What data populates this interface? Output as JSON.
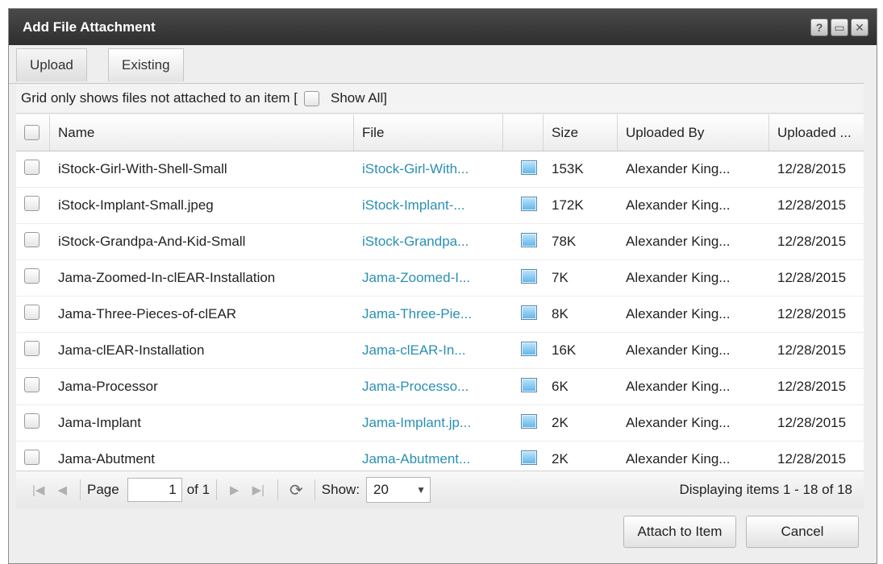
{
  "dialog": {
    "title": "Add File Attachment",
    "help_glyph": "?",
    "maximize_glyph": "▭",
    "close_glyph": "✕"
  },
  "tabs": [
    {
      "label": "Upload"
    },
    {
      "label": "Existing"
    }
  ],
  "filter": {
    "text_before": "Grid only shows files not attached to an item [",
    "show_all_label": "Show All]",
    "show_all_checked": false
  },
  "columns": [
    "Name",
    "File",
    "",
    "Size",
    "Uploaded By",
    "Uploaded ..."
  ],
  "rows": [
    {
      "name": "iStock-Girl-With-Shell-Small",
      "file": "iStock-Girl-With...",
      "size": "153K",
      "by": "Alexander King...",
      "date": "12/28/2015"
    },
    {
      "name": "iStock-Implant-Small.jpeg",
      "file": "iStock-Implant-...",
      "size": "172K",
      "by": "Alexander King...",
      "date": "12/28/2015"
    },
    {
      "name": "iStock-Grandpa-And-Kid-Small",
      "file": "iStock-Grandpa...",
      "size": "78K",
      "by": "Alexander King...",
      "date": "12/28/2015"
    },
    {
      "name": "Jama-Zoomed-In-clEAR-Installation",
      "file": "Jama-Zoomed-I...",
      "size": "7K",
      "by": "Alexander King...",
      "date": "12/28/2015"
    },
    {
      "name": "Jama-Three-Pieces-of-clEAR",
      "file": "Jama-Three-Pie...",
      "size": "8K",
      "by": "Alexander King...",
      "date": "12/28/2015"
    },
    {
      "name": "Jama-clEAR-Installation",
      "file": "Jama-clEAR-In...",
      "size": "16K",
      "by": "Alexander King...",
      "date": "12/28/2015"
    },
    {
      "name": "Jama-Processor",
      "file": "Jama-Processo...",
      "size": "6K",
      "by": "Alexander King...",
      "date": "12/28/2015"
    },
    {
      "name": "Jama-Implant",
      "file": "Jama-Implant.jp...",
      "size": "2K",
      "by": "Alexander King...",
      "date": "12/28/2015"
    },
    {
      "name": "Jama-Abutment",
      "file": "Jama-Abutment...",
      "size": "2K",
      "by": "Alexander King...",
      "date": "12/28/2015"
    }
  ],
  "pager": {
    "first_glyph": "|◀",
    "prev_glyph": "◀",
    "next_glyph": "▶",
    "last_glyph": "▶|",
    "refresh_glyph": "⟳",
    "page_label": "Page",
    "page_value": "1",
    "of_label": "of 1",
    "show_label": "Show:",
    "show_value": "20",
    "show_arrow": "▼",
    "display_text": "Displaying items 1 - 18 of 18"
  },
  "buttons": {
    "attach": "Attach to Item",
    "cancel": "Cancel"
  },
  "colors": {
    "titlebar": "#333333",
    "file_link": "#2a8fb3"
  }
}
